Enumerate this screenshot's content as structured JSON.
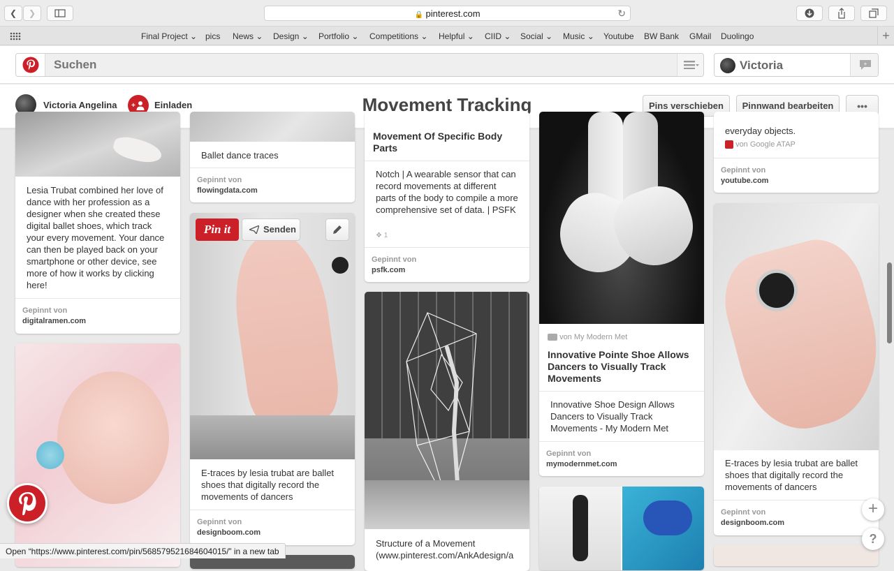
{
  "browser": {
    "url": "pinterest.com"
  },
  "bookmarks": [
    {
      "label": "Final Project",
      "dropdown": true
    },
    {
      "label": "pics",
      "dropdown": false
    },
    {
      "label": "News",
      "dropdown": true
    },
    {
      "label": "Design",
      "dropdown": true
    },
    {
      "label": "Portfolio",
      "dropdown": true
    },
    {
      "label": "Competitions",
      "dropdown": true
    },
    {
      "label": "Helpful",
      "dropdown": true
    },
    {
      "label": "CIID",
      "dropdown": true
    },
    {
      "label": "Social",
      "dropdown": true
    },
    {
      "label": "Music",
      "dropdown": true
    },
    {
      "label": "Youtube",
      "dropdown": false
    },
    {
      "label": "BW Bank",
      "dropdown": false
    },
    {
      "label": "GMail",
      "dropdown": false
    },
    {
      "label": "Duolingo",
      "dropdown": false
    }
  ],
  "header": {
    "search_placeholder": "Suchen",
    "user_name": "Victoria"
  },
  "board": {
    "owner": "Victoria Angelina",
    "invite_label": "Einladen",
    "title": "Movement Tracking",
    "move_pins_label": "Pins verschieben",
    "edit_board_label": "Pinnwand bearbeiten",
    "more_label": "•••"
  },
  "pins": {
    "gepinnt_label": "Gepinnt von",
    "c1a": {
      "text": "Lesia Trubat combined her love of dance with her profession as a designer when she created these digital ballet shoes, which track your every movement. Your dance can then be played back on your smartphone or other device, see more of how it works by clicking here!",
      "domain": "digitalramen.com"
    },
    "c2a": {
      "text": "Ballet dance traces",
      "domain": "flowingdata.com"
    },
    "c2b": {
      "pinit": "Pin it",
      "send": "Senden",
      "text": "E-traces by lesia trubat are ballet shoes that digitally record the movements of dancers",
      "domain": "designboom.com"
    },
    "c3a": {
      "title": "Movement Of Specific Body Parts",
      "text": "Notch | A wearable sensor that can record movements at different parts of the body to compile a more comprehensive set of data. | PSFK",
      "repin_count": "1",
      "domain": "psfk.com"
    },
    "c3b": {
      "text": "Structure of a Movement (www.pinterest.com/AnkAdesign/a"
    },
    "c4a": {
      "source": "von My Modern Met",
      "title": "Innovative Pointe Shoe Allows Dancers to Visually Track Movements",
      "text": "Innovative Shoe Design Allows Dancers to Visually Track Movements - My Modern Met",
      "domain": "mymodernmet.com"
    },
    "c5a": {
      "text": "everyday objects.",
      "source": "von Google ATAP",
      "domain": "youtube.com"
    },
    "c5b": {
      "text": "E-traces by lesia trubat are ballet shoes that digitally record the movements of dancers",
      "domain": "designboom.com"
    }
  },
  "status_bar": {
    "text": "Open “https://www.pinterest.com/pin/568579521684604015/” in a new tab"
  },
  "colors": {
    "pinterest_red": "#cb2027",
    "accent": "#bd081c"
  }
}
